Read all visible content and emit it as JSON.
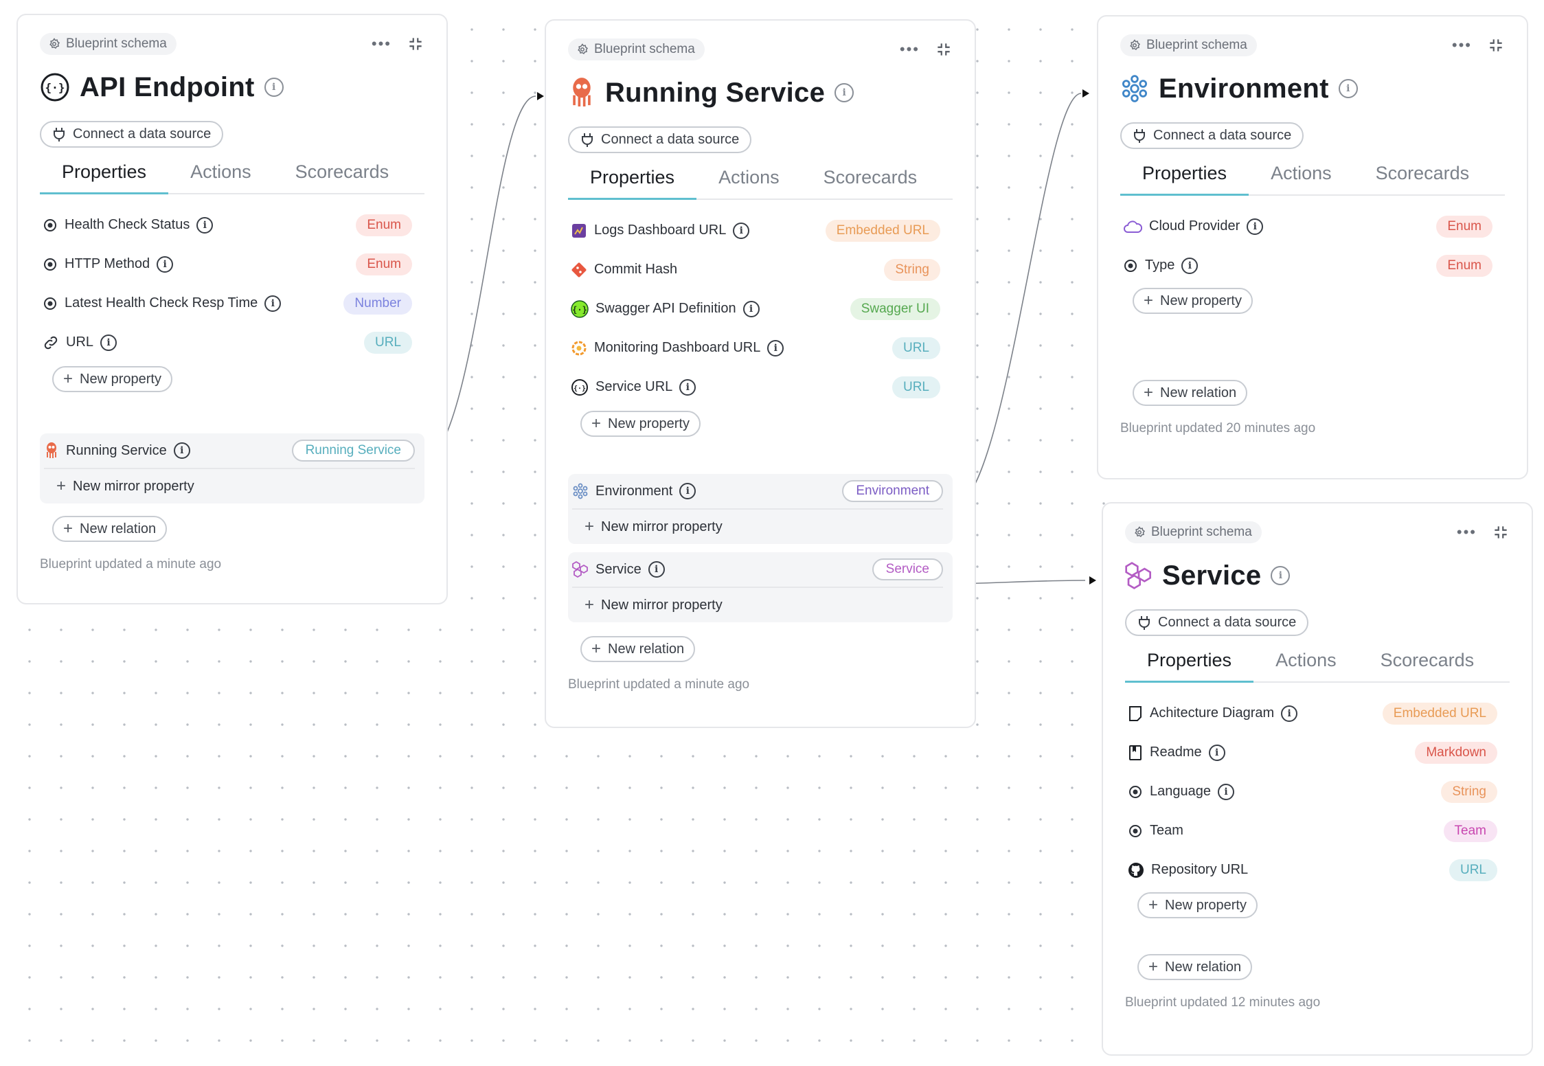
{
  "common": {
    "schema_chip": "Blueprint schema",
    "connect": "Connect a data source",
    "tabs": [
      "Properties",
      "Actions",
      "Scorecards"
    ],
    "new_property": "New property",
    "new_relation": "New relation",
    "new_mirror": "New mirror property",
    "more": "•••"
  },
  "cards": {
    "api": {
      "title": "API Endpoint",
      "properties": [
        {
          "label": "Health Check Status",
          "type": "Enum",
          "icon": "radio-icon"
        },
        {
          "label": "HTTP Method",
          "type": "Enum",
          "icon": "radio-icon"
        },
        {
          "label": "Latest Health Check Resp Time",
          "type": "Number",
          "icon": "radio-icon"
        },
        {
          "label": "URL",
          "type": "URL",
          "icon": "link-icon"
        }
      ],
      "relations": [
        {
          "label": "Running Service",
          "target": "Running Service"
        }
      ],
      "footer": "Blueprint updated a minute ago"
    },
    "running": {
      "title": "Running Service",
      "properties": [
        {
          "label": "Logs Dashboard URL",
          "type": "Embedded URL",
          "icon": "logs-dashboard-icon"
        },
        {
          "label": "Commit Hash",
          "type": "String",
          "icon": "git-icon"
        },
        {
          "label": "Swagger API Definition",
          "type": "Swagger UI",
          "icon": "swagger-icon"
        },
        {
          "label": "Monitoring Dashboard URL",
          "type": "URL",
          "icon": "grafana-icon"
        },
        {
          "label": "Service URL",
          "type": "URL",
          "icon": "api-icon"
        }
      ],
      "relations": [
        {
          "label": "Environment",
          "target": "Environment"
        },
        {
          "label": "Service",
          "target": "Service"
        }
      ],
      "footer": "Blueprint updated a minute ago"
    },
    "environment": {
      "title": "Environment",
      "properties": [
        {
          "label": "Cloud Provider",
          "type": "Enum",
          "icon": "cloud-icon"
        },
        {
          "label": "Type",
          "type": "Enum",
          "icon": "radio-icon"
        }
      ],
      "footer": "Blueprint updated 20 minutes ago"
    },
    "service": {
      "title": "Service",
      "properties": [
        {
          "label": "Achitecture Diagram",
          "type": "Embedded URL",
          "icon": "document-icon"
        },
        {
          "label": "Readme",
          "type": "Markdown",
          "icon": "book-icon"
        },
        {
          "label": "Language",
          "type": "String",
          "icon": "radio-icon"
        },
        {
          "label": "Team",
          "type": "Team",
          "icon": "radio-icon"
        },
        {
          "label": "Repository URL",
          "type": "URL",
          "icon": "github-icon"
        }
      ],
      "footer": "Blueprint updated 12 minutes ago"
    }
  },
  "colors": {
    "tab_accent": "#5fbfcf",
    "environment_relation": "#7b5cc4",
    "service_relation": "#b35cc4",
    "running_relation": "#57aebd"
  }
}
